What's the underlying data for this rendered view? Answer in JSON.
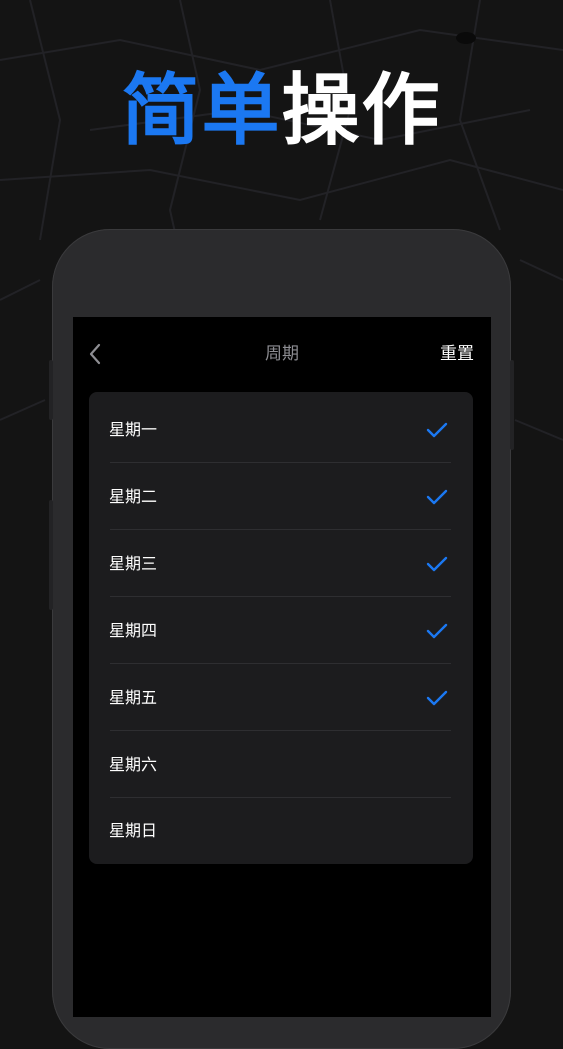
{
  "promo": {
    "title_accent": "简单",
    "title_rest": "操作"
  },
  "nav": {
    "back_icon": "chevron-left-icon",
    "title": "周期",
    "reset_label": "重置"
  },
  "days": [
    {
      "label": "星期一",
      "checked": true
    },
    {
      "label": "星期二",
      "checked": true
    },
    {
      "label": "星期三",
      "checked": true
    },
    {
      "label": "星期四",
      "checked": true
    },
    {
      "label": "星期五",
      "checked": true
    },
    {
      "label": "星期六",
      "checked": false
    },
    {
      "label": "星期日",
      "checked": false
    }
  ],
  "colors": {
    "accent": "#1b78f2",
    "background": "#141414",
    "card": "#1c1c1e",
    "screen": "#000000"
  }
}
